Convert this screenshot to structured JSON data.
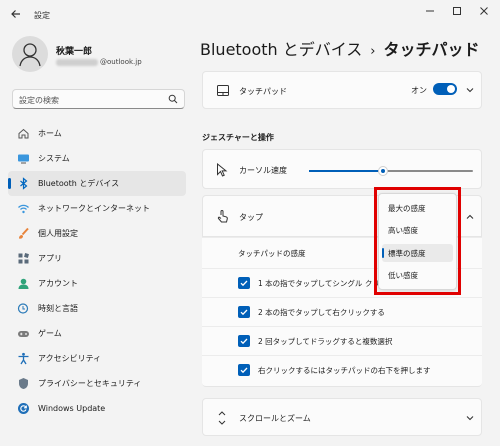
{
  "window": {
    "title": "設定",
    "controls": [
      "minimize",
      "maximize",
      "close"
    ]
  },
  "profile": {
    "name": "秋葉一郎",
    "email_suffix": "@outlook.jp"
  },
  "search": {
    "placeholder": "設定の検索"
  },
  "sidebar": {
    "items": [
      {
        "label": "ホーム",
        "icon": "home-icon"
      },
      {
        "label": "システム",
        "icon": "system-icon"
      },
      {
        "label": "Bluetooth とデバイス",
        "icon": "bluetooth-icon",
        "selected": true
      },
      {
        "label": "ネットワークとインターネット",
        "icon": "wifi-icon"
      },
      {
        "label": "個人用設定",
        "icon": "brush-icon"
      },
      {
        "label": "アプリ",
        "icon": "apps-icon"
      },
      {
        "label": "アカウント",
        "icon": "account-icon"
      },
      {
        "label": "時刻と言語",
        "icon": "globe-clock-icon"
      },
      {
        "label": "ゲーム",
        "icon": "gamepad-icon"
      },
      {
        "label": "アクセシビリティ",
        "icon": "accessibility-icon"
      },
      {
        "label": "プライバシーとセキュリティ",
        "icon": "shield-icon"
      },
      {
        "label": "Windows Update",
        "icon": "update-icon"
      }
    ]
  },
  "breadcrumb": {
    "parent": "Bluetooth とデバイス",
    "separator": "›",
    "current": "タッチパッド"
  },
  "touchpad": {
    "label": "タッチパッド",
    "state": "オン",
    "on": true
  },
  "gestures_section": "ジェスチャーと操作",
  "cursor_speed": {
    "label": "カーソル速度",
    "value_fraction": 0.45
  },
  "tap": {
    "label": "タップ",
    "sensitivity_label": "タッチパッドの感度",
    "options": [
      {
        "label": "1 本の指でタップしてシングル クリックする",
        "checked": true
      },
      {
        "label": "2 本の指でタップして右クリックする",
        "checked": true
      },
      {
        "label": "2 回タップしてドラッグすると複数選択",
        "checked": true
      },
      {
        "label": "右クリックするにはタッチパッドの右下を押します",
        "checked": true
      }
    ]
  },
  "sensitivity_dropdown": {
    "items": [
      "最大の感度",
      "高い感度",
      "標準の感度",
      "低い感度"
    ],
    "selected_index": 2
  },
  "scroll_zoom": {
    "label": "スクロールとズーム"
  },
  "colors": {
    "accent": "#005fb8",
    "highlight": "#e00000"
  }
}
